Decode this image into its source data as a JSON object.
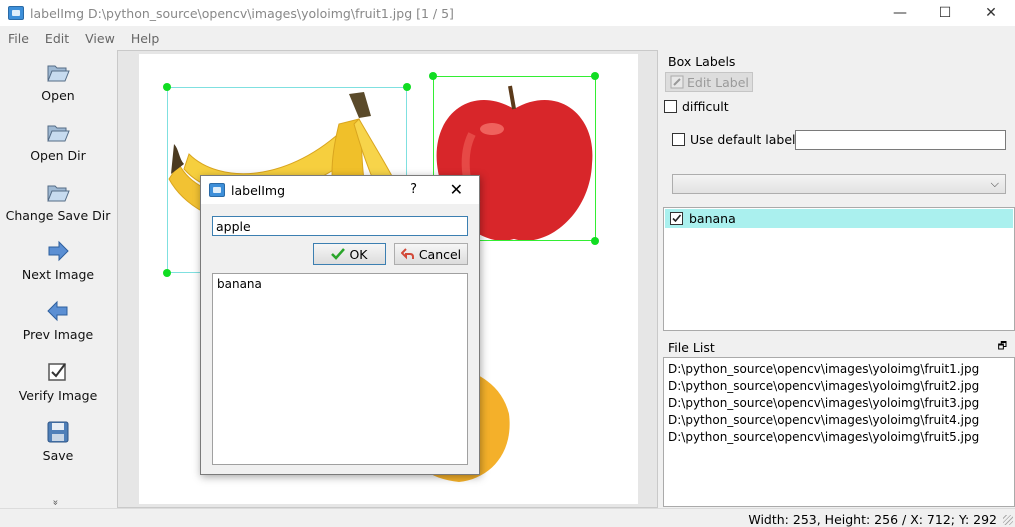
{
  "window": {
    "title": "labelImg D:\\python_source\\opencv\\images\\yoloimg\\fruit1.jpg [1 / 5]",
    "minimize": "—",
    "maximize": "☐",
    "close": "✕"
  },
  "menu": [
    "File",
    "Edit",
    "View",
    "Help"
  ],
  "toolbar": [
    {
      "label": "Open",
      "icon": "folder-open-icon"
    },
    {
      "label": "Open Dir",
      "icon": "folder-open-icon"
    },
    {
      "label": "Change Save Dir",
      "icon": "folder-open-icon"
    },
    {
      "label": "Next Image",
      "icon": "arrow-right-icon"
    },
    {
      "label": "Prev Image",
      "icon": "arrow-left-icon"
    },
    {
      "label": "Verify Image",
      "icon": "checkbox-icon"
    },
    {
      "label": "Save",
      "icon": "floppy-disk-icon"
    }
  ],
  "toolbar_more": "»",
  "dialog": {
    "title": "labelImg",
    "help": "?",
    "close": "✕",
    "input_value": "apple",
    "ok_label": "OK",
    "cancel_label": "Cancel",
    "list_items": [
      "banana"
    ]
  },
  "box_labels": {
    "title": "Box Labels",
    "edit_label": "Edit Label",
    "difficult_label": "difficult",
    "difficult_checked": false,
    "use_default_label": "Use default label",
    "use_default_checked": false,
    "default_label_value": "",
    "combo_value": "",
    "labels": [
      {
        "name": "banana",
        "checked": true
      }
    ]
  },
  "file_list": {
    "title": "File List",
    "files": [
      "D:\\python_source\\opencv\\images\\yoloimg\\fruit1.jpg",
      "D:\\python_source\\opencv\\images\\yoloimg\\fruit2.jpg",
      "D:\\python_source\\opencv\\images\\yoloimg\\fruit3.jpg",
      "D:\\python_source\\opencv\\images\\yoloimg\\fruit4.jpg",
      "D:\\python_source\\opencv\\images\\yoloimg\\fruit5.jpg"
    ]
  },
  "status": "Width: 253, Height: 256 / X: 712; Y: 292",
  "colors": {
    "selected_row": "#aaf0ee",
    "bbox_existing": "#7fe0e0",
    "bbox_new": "#33ee33",
    "vertex": "#11dd22"
  }
}
